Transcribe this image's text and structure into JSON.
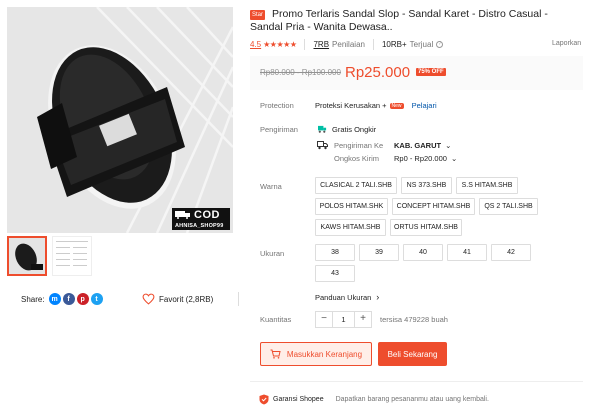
{
  "product": {
    "star_badge": "Star",
    "title": "Promo Terlaris Sandal Slop - Sandal Karet - Distro Casual - Sandal Pria - Wanita Dewasa..",
    "rating": "4.5",
    "stars": "★★★★★",
    "ratings_count": "7RB",
    "ratings_label": "Penilaian",
    "sold_count": "10RB+",
    "sold_label": "Terjual",
    "report_label": "Laporkan"
  },
  "price": {
    "old": "Rp80.000 - Rp100.000",
    "current": "Rp25.000",
    "discount": "75% OFF"
  },
  "protection": {
    "label": "Protection",
    "value": "Proteksi Kerusakan +",
    "new_tag": "New",
    "link": "Pelajari"
  },
  "shipping": {
    "label": "Pengiriman",
    "free": "Gratis Ongkir",
    "to_label": "Pengiriman Ke",
    "to_value": "KAB. GARUT",
    "cost_label": "Ongkos Kirim",
    "cost_value": "Rp0 - Rp20.000"
  },
  "variants": {
    "color_label": "Warna",
    "colors": [
      "CLASICAL 2 TALI.SHB",
      "NS 373.SHB",
      "S.S HITAM.SHB",
      "POLOS HITAM.SHK",
      "CONCEPT HITAM.SHB",
      "QS 2 TALI.SHB",
      "KAWS HITAM.SHB",
      "ORTUS HITAM.SHB"
    ],
    "size_label": "Ukuran",
    "sizes": [
      "38",
      "39",
      "40",
      "41",
      "42",
      "43"
    ],
    "size_guide": "Panduan Ukuran"
  },
  "quantity": {
    "label": "Kuantitas",
    "minus": "−",
    "value": "1",
    "plus": "+",
    "stock": "tersisa 479228 buah"
  },
  "actions": {
    "add_to_cart": "Masukkan Keranjang",
    "buy_now": "Beli Sekarang"
  },
  "guarantee": {
    "label": "Garansi Shopee",
    "text": "Dapatkan barang pesananmu atau uang kembali."
  },
  "share": {
    "label": "Share:",
    "icons": [
      "messenger-icon",
      "facebook-icon",
      "pinterest-icon",
      "twitter-icon"
    ]
  },
  "favorite": {
    "label": "Favorit (2,8RB)"
  },
  "image_badge": {
    "cod": "COD",
    "shop": "AHNISA_SHOP99"
  },
  "colors": {
    "accent": "#ee4d2d",
    "link": "#0055aa"
  }
}
